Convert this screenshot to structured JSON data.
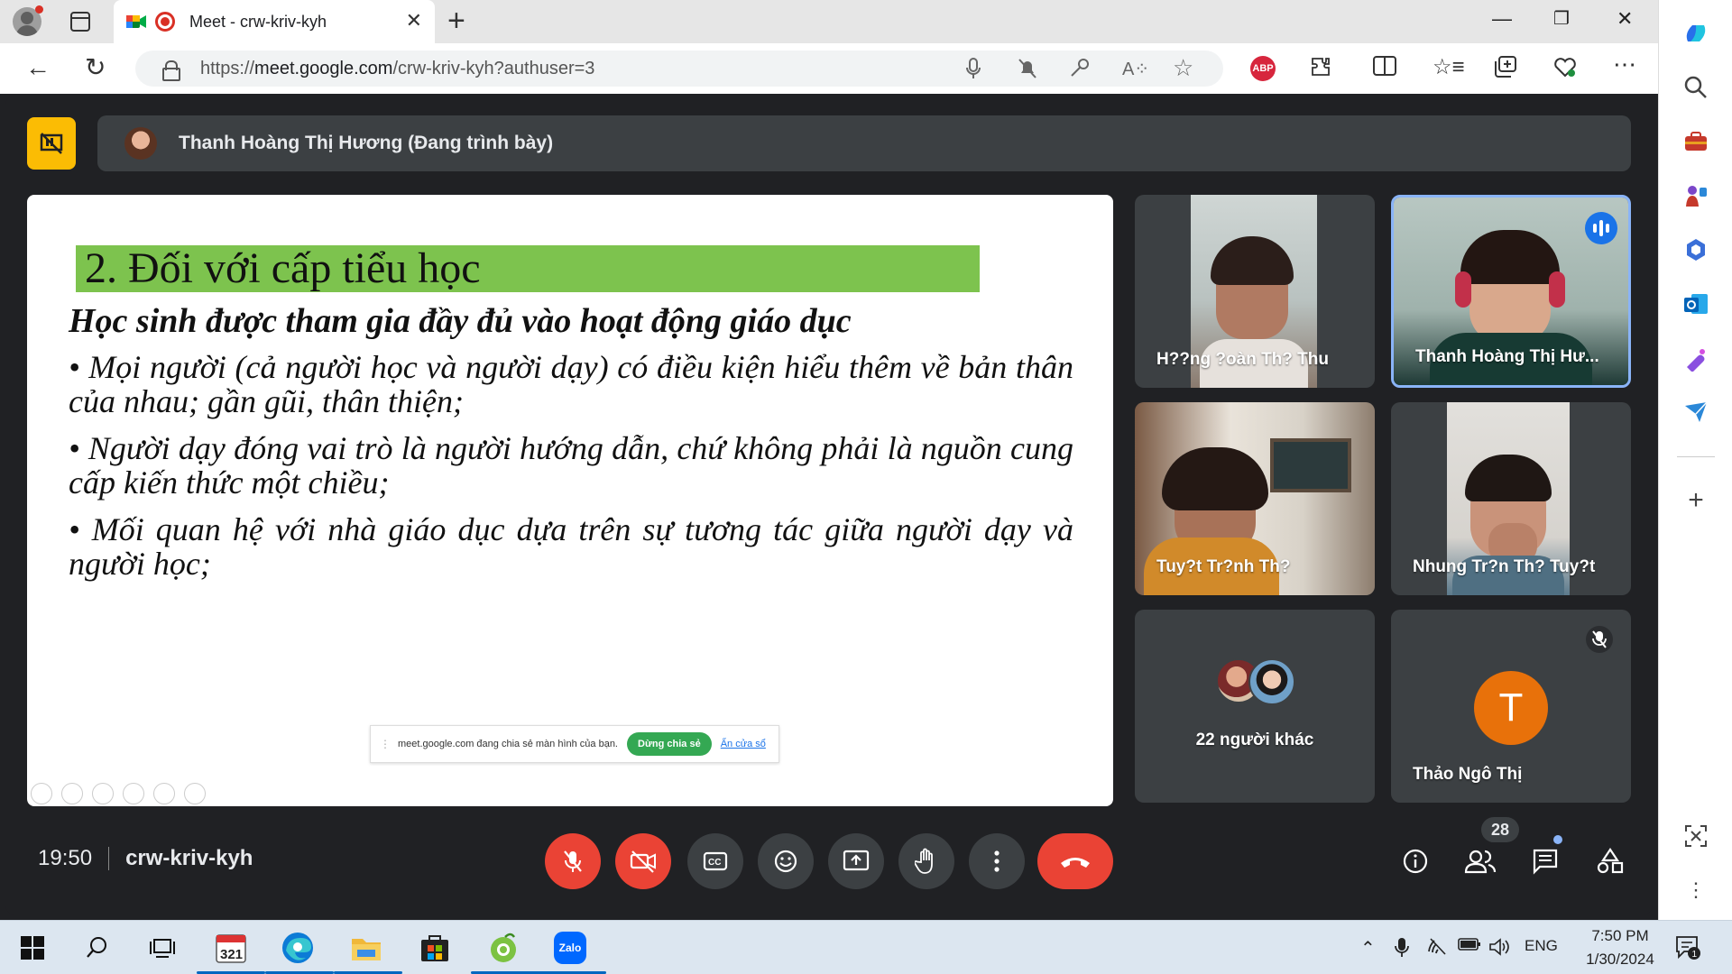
{
  "browser": {
    "tab_title": "Meet - crw-kriv-kyh",
    "url_prefix": "https://",
    "url_host": "meet.google.com",
    "url_path": "/crw-kriv-kyh?authuser=3",
    "abp_label": "ABP"
  },
  "meet": {
    "presenter_label": "Thanh Hoàng Thị Hương (Đang trình bày)",
    "meeting_time": "19:50",
    "meeting_code": "crw-kriv-kyh",
    "participant_count": "28"
  },
  "slide": {
    "title": "2. Đối với cấp tiểu học",
    "subtitle": "Học sinh được tham gia đầy đủ vào hoạt động giáo dục",
    "bullets": [
      "• Mọi người (cả người học và người dạy) có điều kiện hiểu thêm về bản thân của nhau; gần gũi, thân thiện;",
      "• Người dạy đóng vai trò là người hướng dẫn, chứ không phải là nguồn cung cấp kiến thức một chiều;",
      "• Mối quan hệ với nhà giáo dục dựa trên sự tương tác giữa người dạy và người học;"
    ],
    "share_notice": "meet.google.com đang chia sẻ màn hình của bạn.",
    "share_stop": "Dừng chia sẻ",
    "share_hide": "Ẩn cửa sổ"
  },
  "participants": [
    {
      "name": "H??ng ?oàn Th? Thu"
    },
    {
      "name": "Thanh Hoàng Thị Hư..."
    },
    {
      "name": "Tuy?t Tr?nh Th?"
    },
    {
      "name": "Nhung Tr?n Th? Tuy?t"
    },
    {
      "name": "22 người khác"
    },
    {
      "name": "Thảo Ngô Thị",
      "initial": "T"
    }
  ],
  "taskbar": {
    "calendar_day": "321",
    "zalo": "Zalo",
    "lang": "ENG",
    "time": "7:50 PM",
    "date": "1/30/2024",
    "notif_count": "1"
  },
  "colors": {
    "accent_yellow": "#fbbc04",
    "end_call_red": "#ea4335",
    "slide_title_green": "#7dc34e",
    "speaking_blue": "#1a73e8",
    "avatar_orange": "#e8710a"
  }
}
